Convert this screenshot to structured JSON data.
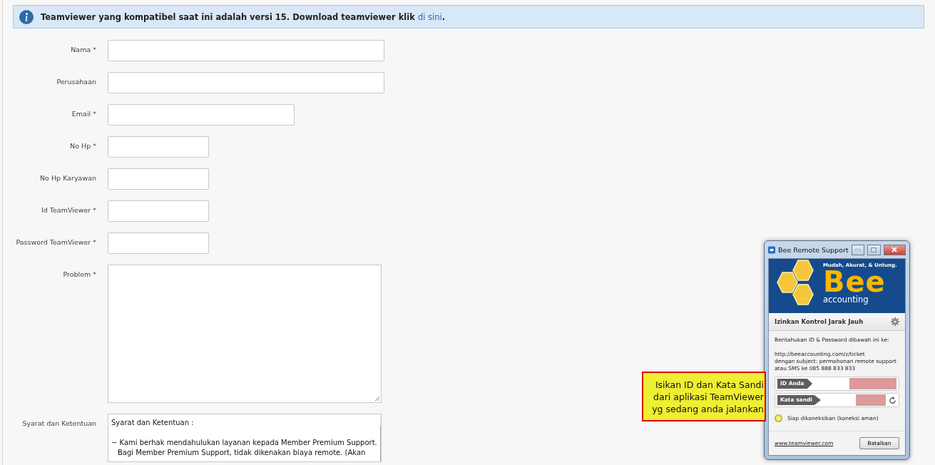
{
  "alert": {
    "text": "Teamviewer yang kompatibel saat ini adalah versi 15. Download teamviewer klik ",
    "link": "di sini",
    "tail": "."
  },
  "fields": [
    {
      "label": "Nama *",
      "kind": "wide"
    },
    {
      "label": "Perusahaan",
      "kind": "wide"
    },
    {
      "label": "Email *",
      "kind": "medium"
    },
    {
      "label": "No Hp *",
      "kind": "short"
    },
    {
      "label": "No Hp Karyawan",
      "kind": "short"
    },
    {
      "label": "Id TeamViewer *",
      "kind": "short"
    },
    {
      "label": "Password TeamViewer *",
      "kind": "short"
    },
    {
      "label": "Problem *",
      "kind": "textarea"
    },
    {
      "label": "Syarat dan Ketentuan",
      "kind": "terms"
    }
  ],
  "terms": {
    "title": "Syarat dan Ketentuan :",
    "lines": [
      "− Kami berhak mendahulukan layanan kepada Member Premium Support.",
      "Bagi Member Premium Support, tidak dikenakan biaya remote. (Akan"
    ]
  },
  "remote_window": {
    "title": "Bee Remote Support",
    "tagline": "Mudah, Akurat, & Untung.",
    "brand": "Bee",
    "brand_sub": "accounting",
    "section": "Izinkan Kontrol Jarak Jauh",
    "instruction": "Beritahukan ID & Password dibawah ini ke:",
    "lines": [
      "http://beeaccounting.com/z/ticket",
      "dengan subject: permohonan remote support",
      "atau SMS ke 085 888 833 833"
    ],
    "credentials": [
      {
        "label": "ID Anda",
        "kind": "id"
      },
      {
        "label": "Kata sandi",
        "kind": "password"
      }
    ],
    "status": "Siap dikoneksikan (koneksi aman)",
    "link": "www.teamviewer.com",
    "button": "Batalkan"
  },
  "callout": {
    "lines": [
      "Isikan ID dan Kata Sandi",
      "dari aplikasi TeamViewer",
      "yg sedang anda jalankan"
    ]
  }
}
